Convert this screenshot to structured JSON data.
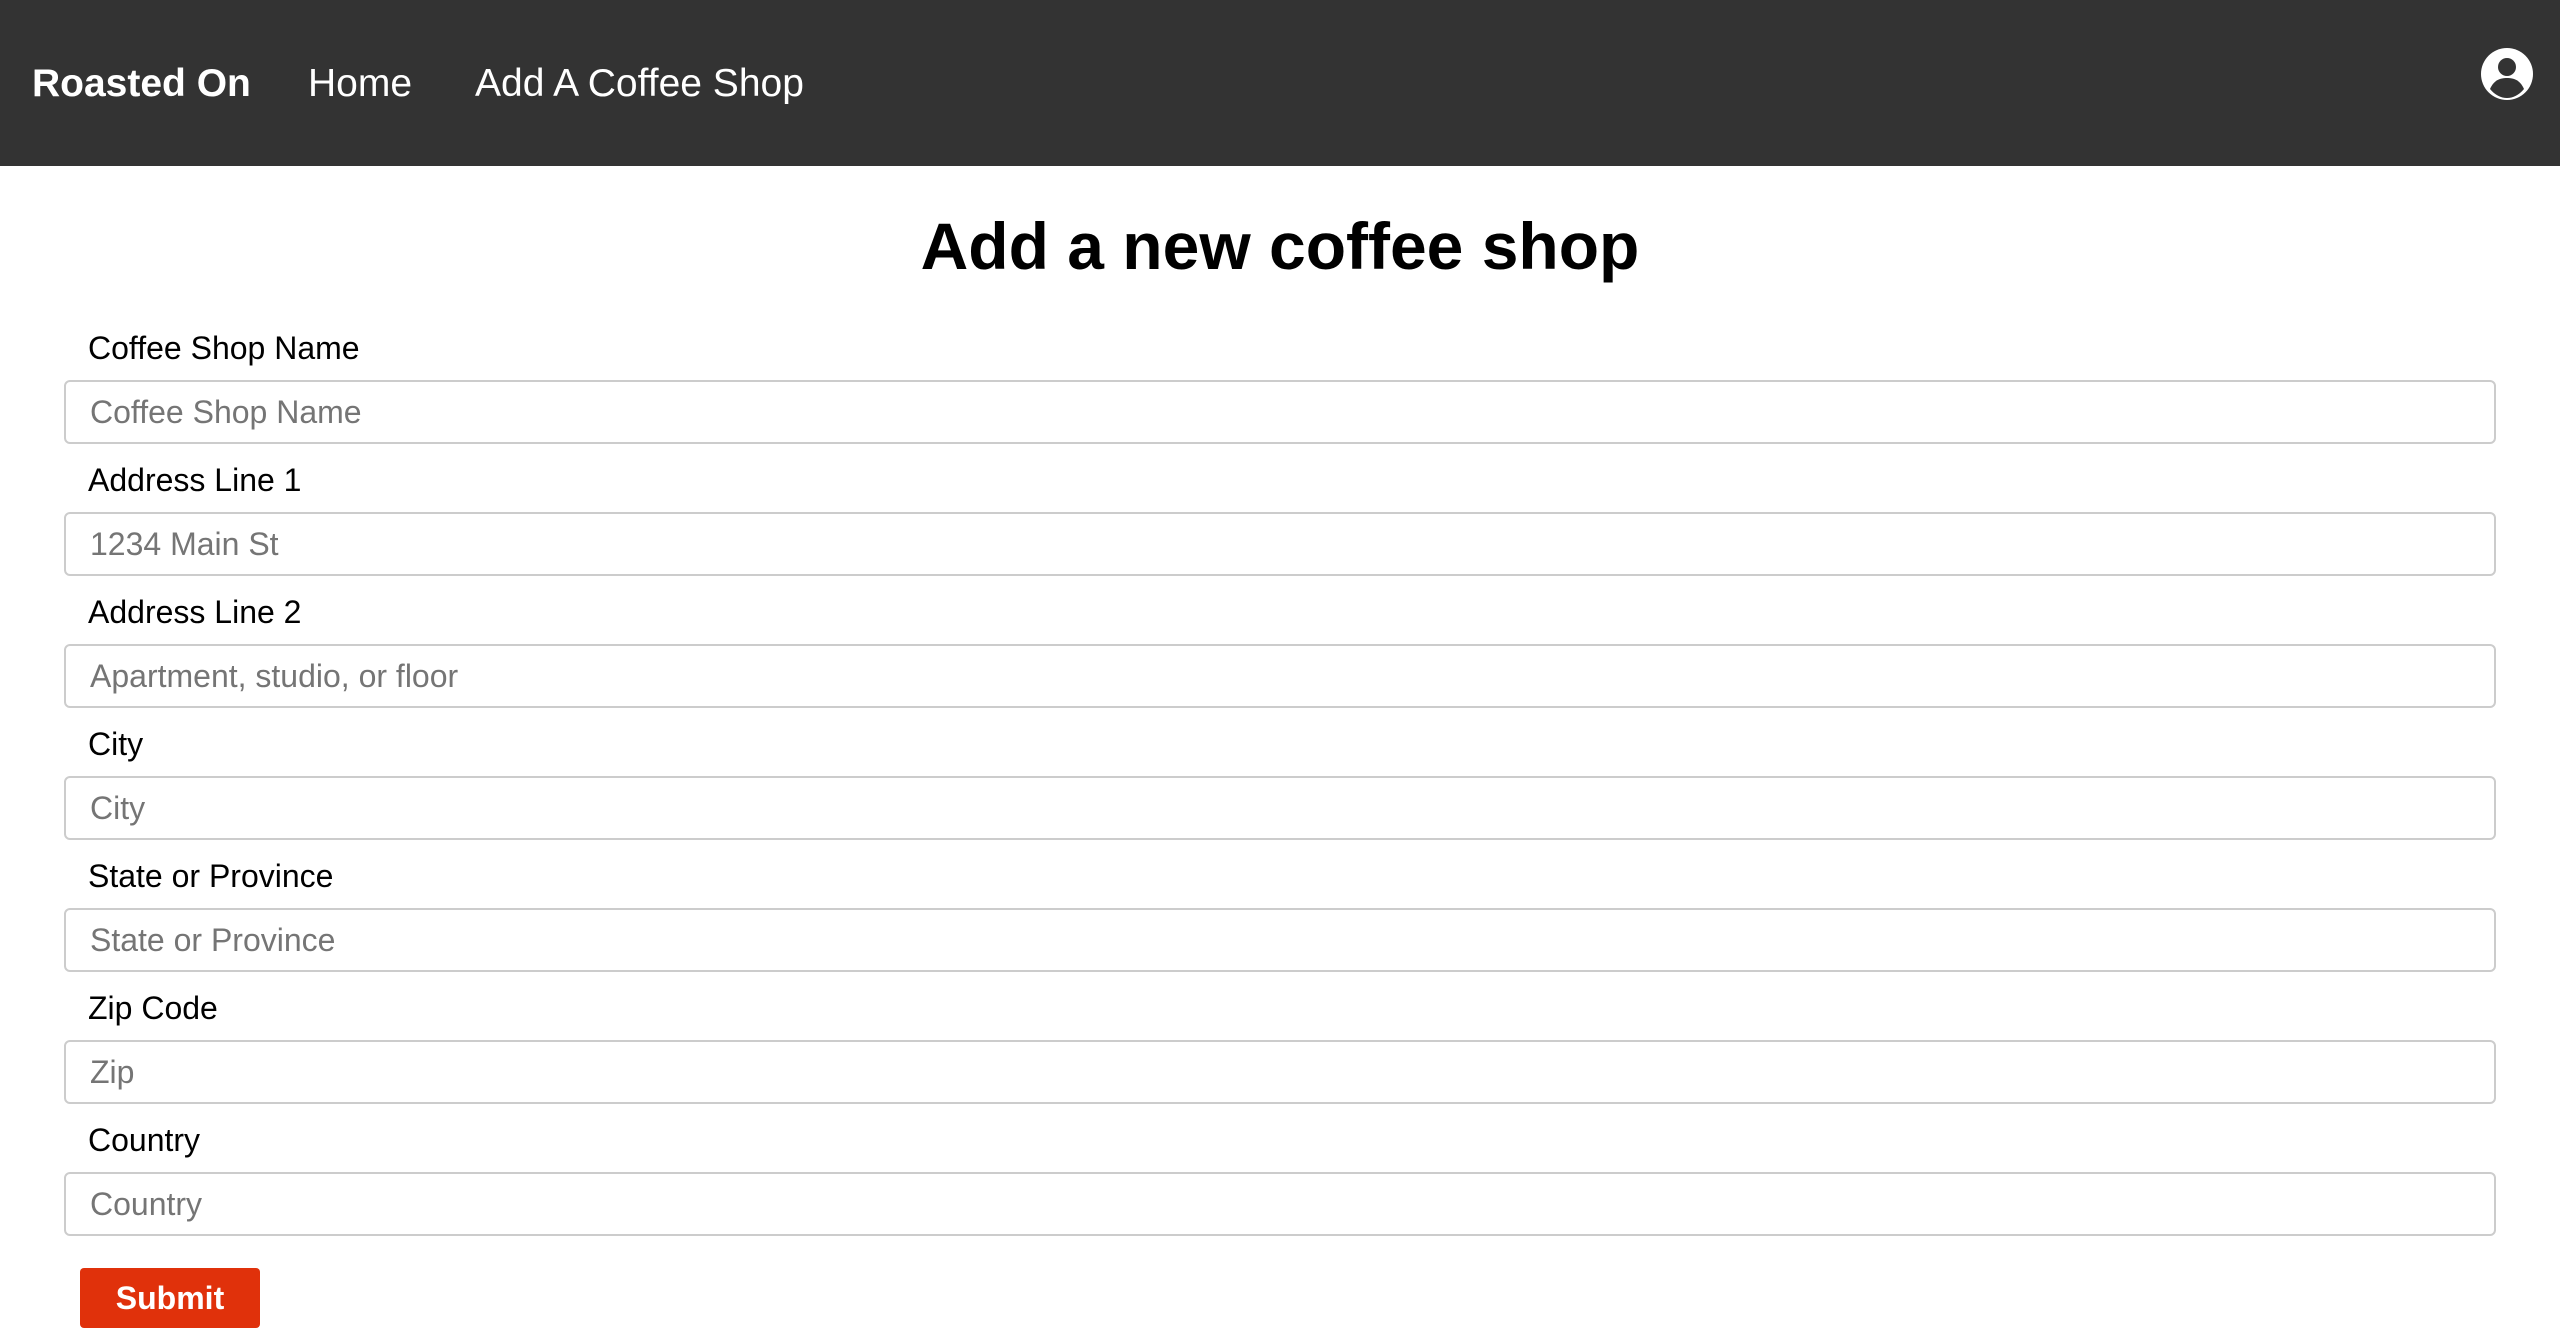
{
  "colors": {
    "navbar_bg": "#333333",
    "nav_text": "#ffffff",
    "submit_bg": "#e0310b",
    "submit_text": "#ffffff",
    "input_border": "#cccccc",
    "placeholder": "#757575"
  },
  "navbar": {
    "brand": "Roasted On",
    "links": [
      {
        "label": "Home"
      },
      {
        "label": "Add A Coffee Shop"
      }
    ],
    "account_icon": "account-circle-icon"
  },
  "page": {
    "title": "Add a new coffee shop"
  },
  "form": {
    "fields": [
      {
        "label": "Coffee Shop Name",
        "placeholder": "Coffee Shop Name",
        "value": ""
      },
      {
        "label": "Address Line 1",
        "placeholder": "1234 Main St",
        "value": ""
      },
      {
        "label": "Address Line 2",
        "placeholder": "Apartment, studio, or floor",
        "value": ""
      },
      {
        "label": "City",
        "placeholder": "City",
        "value": ""
      },
      {
        "label": "State or Province",
        "placeholder": "State or Province",
        "value": ""
      },
      {
        "label": "Zip Code",
        "placeholder": "Zip",
        "value": ""
      },
      {
        "label": "Country",
        "placeholder": "Country",
        "value": ""
      }
    ],
    "submit_label": "Submit"
  }
}
